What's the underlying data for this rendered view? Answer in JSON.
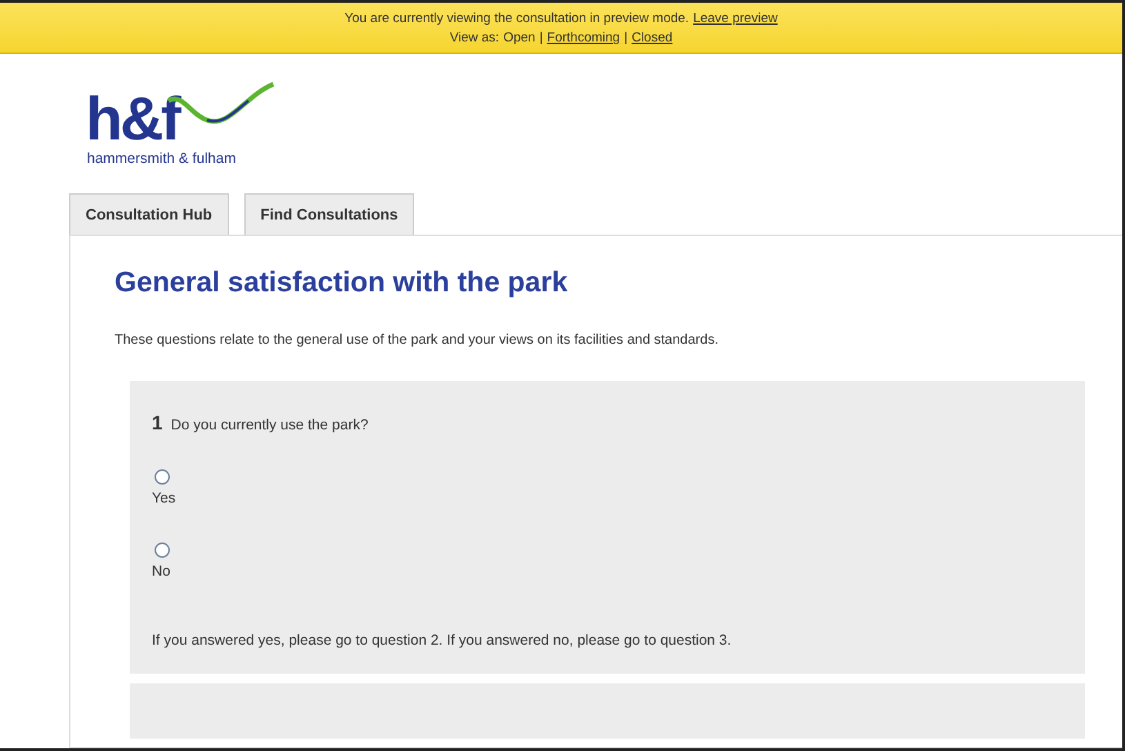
{
  "preview_banner": {
    "message": "You are currently viewing the consultation in preview mode.",
    "leave_link": "Leave preview",
    "view_as_label": "View as:",
    "separator": "|",
    "view_options": [
      {
        "label": "Open",
        "link": false
      },
      {
        "label": "Forthcoming",
        "link": true
      },
      {
        "label": "Closed",
        "link": true
      }
    ]
  },
  "logo": {
    "mark": "h&f",
    "name": "hammersmith & fulham"
  },
  "tabs": [
    {
      "label": "Consultation Hub",
      "selected": false
    },
    {
      "label": "Find Consultations",
      "selected": false
    }
  ],
  "page": {
    "title": "General satisfaction with the park",
    "intro": "These questions relate to the general use of the park and your views on its facilities and standards."
  },
  "questions": [
    {
      "number": "1",
      "text": "Do you currently use the park?",
      "options": [
        {
          "label": "Yes",
          "selected": false
        },
        {
          "label": "No",
          "selected": false
        }
      ],
      "note": "If you answered yes, please go to question 2. If you answered no, please go to question 3."
    }
  ]
}
